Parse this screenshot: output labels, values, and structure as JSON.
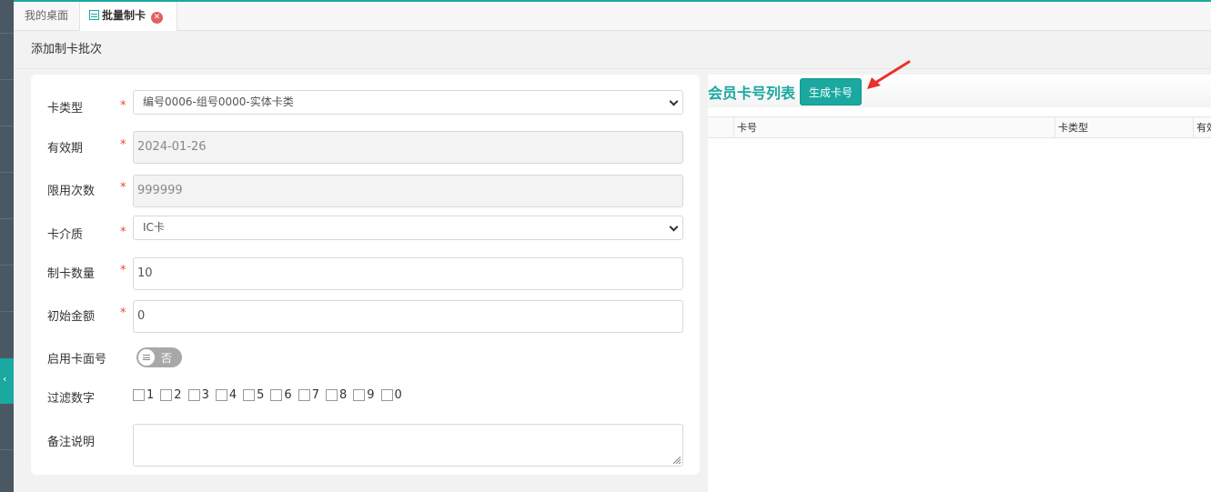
{
  "tabs": [
    {
      "label": "我的桌面"
    },
    {
      "label": "批量制卡"
    }
  ],
  "page": {
    "title": "添加制卡批次"
  },
  "form": {
    "card_type": {
      "label": "卡类型",
      "value": "编号0006-组号0000-实体卡类"
    },
    "valid_date": {
      "label": "有效期",
      "value": "2024-01-26"
    },
    "limit_count": {
      "label": "限用次数",
      "value": "999999"
    },
    "card_medium": {
      "label": "卡介质",
      "value": "IC卡"
    },
    "card_quantity": {
      "label": "制卡数量",
      "value": "10"
    },
    "initial_amount": {
      "label": "初始金额",
      "value": "0"
    },
    "enable_face_number": {
      "label": "启用卡面号",
      "toggle_text": "否"
    },
    "filter_digits": {
      "label": "过滤数字",
      "options": [
        "1",
        "2",
        "3",
        "4",
        "5",
        "6",
        "7",
        "8",
        "9",
        "0"
      ]
    },
    "remark": {
      "label": "备注说明",
      "value": ""
    },
    "required_mark": "*"
  },
  "right_panel": {
    "title": "会员卡号列表",
    "generate_button": "生成卡号",
    "columns": [
      "卡号",
      "卡类型",
      "有效"
    ]
  },
  "colors": {
    "accent": "#1aa8a0",
    "required": "#e43333",
    "arrow": "#e8322b"
  }
}
